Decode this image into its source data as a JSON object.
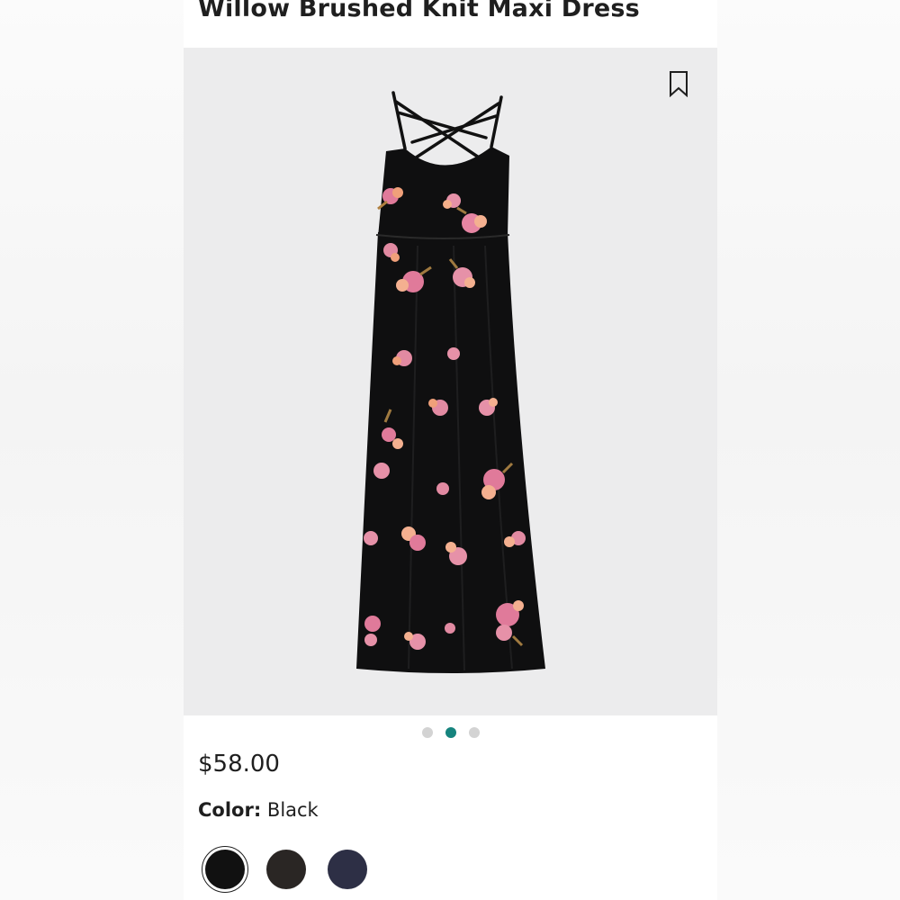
{
  "product": {
    "title": "Willow Brushed Knit Maxi Dress",
    "price": "$58.00",
    "color_label": "Color:",
    "color_value": "Black",
    "image_description_icon": "bookmark-icon"
  },
  "carousel": {
    "total": 3,
    "active_index": 1
  },
  "swatches": [
    {
      "name": "black",
      "color": "#111111",
      "selected": true
    },
    {
      "name": "charcoal",
      "color": "#2a2624",
      "selected": false
    },
    {
      "name": "navy",
      "color": "#2d2f45",
      "selected": false
    }
  ],
  "colors": {
    "image_bg": "#ececed",
    "dress": "#0f0f10",
    "accent_dot": "#16847e"
  }
}
